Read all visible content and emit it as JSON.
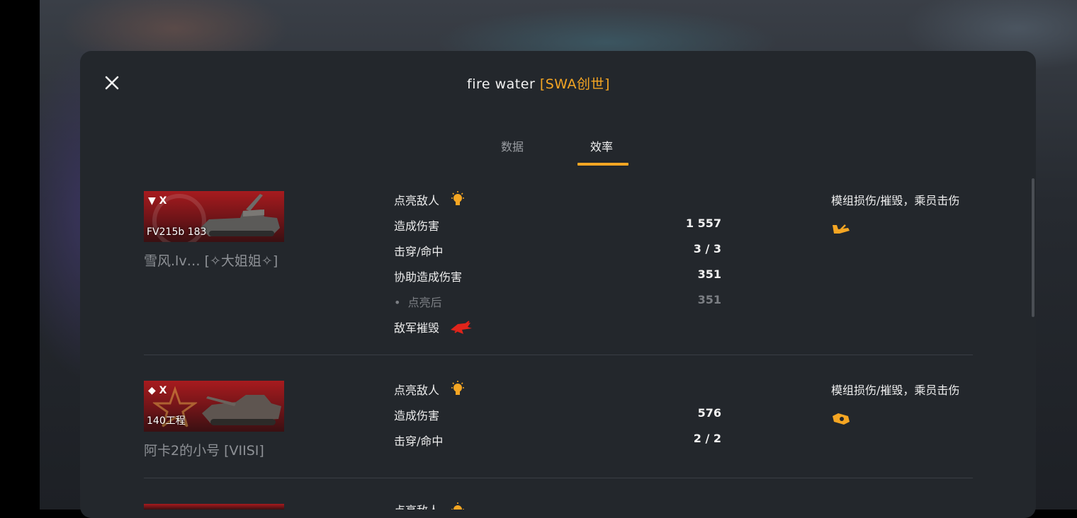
{
  "header": {
    "player_name": "fire  water",
    "clan_tag": "[SWA创世]",
    "close_icon": "close-icon"
  },
  "tabs": [
    {
      "label": "数据",
      "active": false
    },
    {
      "label": "效率",
      "active": true
    }
  ],
  "colors": {
    "accent": "#f5a623",
    "destroyed_red": "#e0241b",
    "tank_card_red": "#a71b1e"
  },
  "entries": [
    {
      "tier_label": "X",
      "tank_name": "FV215b 183",
      "player": "雪风.lv…  [✧大姐姐✧]",
      "stats": {
        "spotted_label": "点亮敌人",
        "damage_label": "造成伤害",
        "damage_value": "1 557",
        "pen_label": "击穿/命中",
        "pen_value": "3 / 3",
        "assist_label": "协助造成伤害",
        "assist_value": "351",
        "assist_spot_label": "点亮后",
        "assist_spot_value": "351",
        "kills_label": "敌军摧毁"
      },
      "right_title": "模组损伤/摧毁，乘员击伤",
      "right_icon": "track-damage-icon"
    },
    {
      "tier_label": "X",
      "tank_name": "140工程",
      "player": "阿卡2的小号 [VIISI]",
      "stats": {
        "spotted_label": "点亮敌人",
        "damage_label": "造成伤害",
        "damage_value": "576",
        "pen_label": "击穿/命中",
        "pen_value": "2 / 2"
      },
      "right_title": "模组损伤/摧毁，乘员击伤",
      "right_icon": "module-damage-icon"
    },
    {
      "stats": {
        "spotted_label": "点亮敌人"
      }
    }
  ]
}
